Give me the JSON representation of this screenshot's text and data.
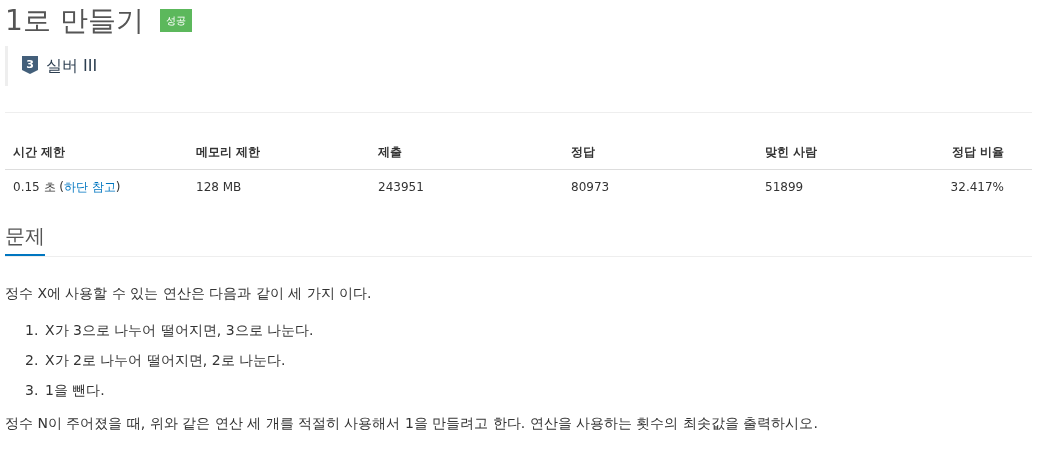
{
  "title": "1로 만들기",
  "result_badge": {
    "text": "성공",
    "kind": "success"
  },
  "tier": {
    "kind": "silver",
    "number": "3",
    "label": "실버 III"
  },
  "info_table": {
    "columns": [
      "시간 제한",
      "메모리 제한",
      "제출",
      "정답",
      "맞힌 사람",
      "정답 비율"
    ],
    "rows": [
      [
        [
          {
            "kind": "text",
            "text": "0.15 초 ("
          },
          {
            "kind": "link",
            "text": "하단 참고"
          },
          {
            "kind": "text",
            "text": ")"
          }
        ],
        [
          {
            "kind": "text",
            "text": "128 MB"
          }
        ],
        [
          {
            "kind": "text",
            "text": "243951"
          }
        ],
        [
          {
            "kind": "text",
            "text": "80973"
          }
        ],
        [
          {
            "kind": "text",
            "text": "51899"
          }
        ],
        [
          {
            "kind": "text",
            "text": "32.417%"
          }
        ]
      ]
    ]
  },
  "section": {
    "heading": "문제",
    "body": [
      {
        "kind": "paragraph",
        "text": "정수 X에 사용할 수 있는 연산은 다음과 같이 세 가지 이다."
      },
      {
        "kind": "list",
        "items": [
          {
            "marker": "1.",
            "text": "X가 3으로 나누어 떨어지면, 3으로 나눈다."
          },
          {
            "marker": "2.",
            "text": "X가 2로 나누어 떨어지면, 2로 나눈다."
          },
          {
            "marker": "3.",
            "text": "1을 뺀다."
          }
        ]
      },
      {
        "kind": "paragraph",
        "text": "정수 N이 주어졌을 때, 위와 같은 연산 세 개를 적절히 사용해서 1을 만들려고 한다. 연산을 사용하는 횟수의 최솟값을 출력하시오."
      }
    ]
  }
}
